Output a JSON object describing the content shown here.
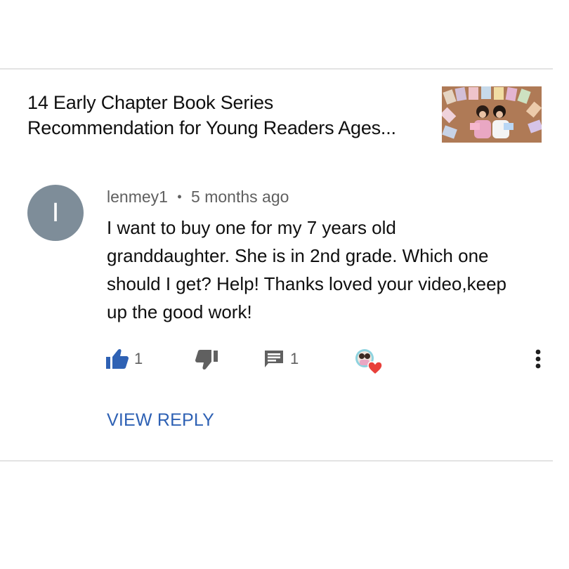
{
  "video": {
    "title_line1": "14 Early Chapter Book Series",
    "title_line2": "Recommendation for Young Readers Ages..."
  },
  "comment": {
    "avatar_letter": "I",
    "author": "lenmey1",
    "separator": "•",
    "time": "5 months ago",
    "text_lines": [
      "I want to buy one for my 7 years old",
      "granddaughter. She is in 2nd grade. Which one",
      "should I get? Help! Thanks loved your video,keep",
      "up the good work!"
    ]
  },
  "actions": {
    "likes": "1",
    "replies": "1",
    "like_icon": "thumbs-up-icon",
    "dislike_icon": "thumbs-down-icon",
    "reply_icon": "comment-icon",
    "hearted_icon": "creator-heart-icon",
    "more_icon": "more-vertical-icon"
  },
  "view_reply_label": "VIEW REPLY",
  "colors": {
    "link_blue": "#2e61b4",
    "avatar_gray": "#7e8d99",
    "heart_red": "#e8403a",
    "icon_gray": "#606060"
  }
}
